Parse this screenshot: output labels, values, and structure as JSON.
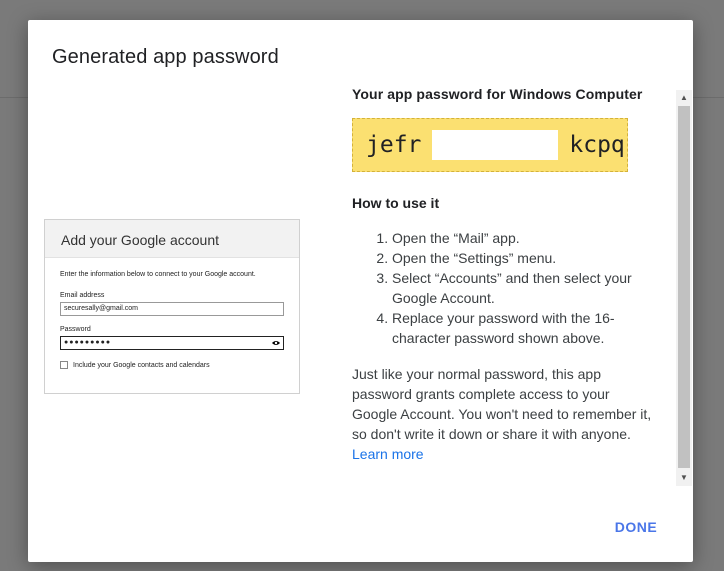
{
  "dialog": {
    "title": "Generated app password",
    "done_label": "DONE"
  },
  "preview": {
    "header": "Add your Google account",
    "description": "Enter the information below to connect to your Google account.",
    "email_label": "Email address",
    "email_value": "securesally@gmail.com",
    "password_label": "Password",
    "password_value": "●●●●●●●●●",
    "checkbox_label": "Include your Google contacts and calendars"
  },
  "password_panel": {
    "heading": "Your app password for Windows Computer",
    "pw_start": "jefr",
    "pw_end": "kcpq"
  },
  "howto": {
    "heading": "How to use it",
    "steps": [
      "Open the “Mail” app.",
      "Open the “Settings” menu.",
      "Select “Accounts” and then select your Google Account.",
      "Replace your password with the 16-character password shown above."
    ],
    "paragraph": "Just like your normal password, this app password grants complete access to your Google Account. You won't need to remember it, so don't write it down or share it with anyone.",
    "learn_more": "Learn more"
  },
  "icons": {
    "eye": "eye-icon",
    "scroll_up": "scroll-up-arrow-icon",
    "scroll_down": "scroll-down-arrow-icon"
  },
  "colors": {
    "password_box": "#fbe071",
    "accent": "#1a73e8",
    "done": "#4a76e8"
  }
}
